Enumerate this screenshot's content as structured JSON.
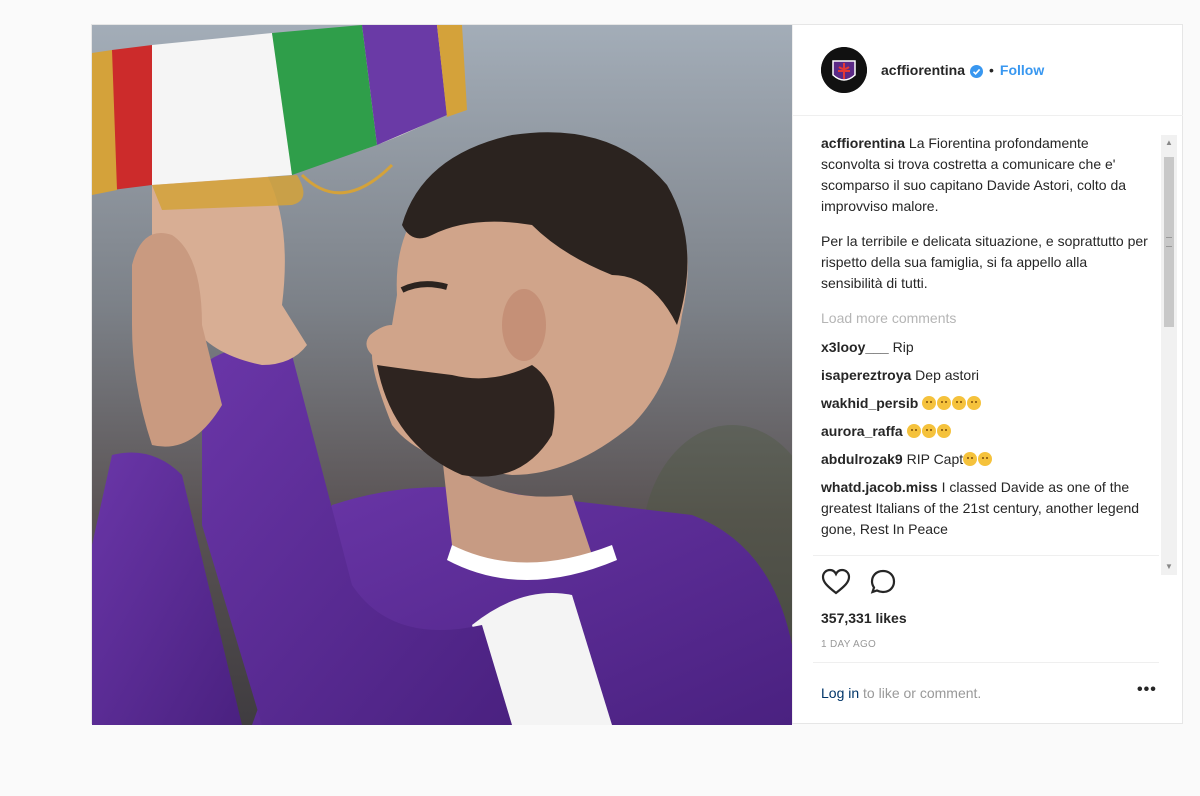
{
  "post": {
    "username": "acffiorentina",
    "follow_label": "Follow",
    "separator": "•",
    "caption_username": "acffiorentina",
    "caption_paragraph_1": "La Fiorentina profondamente sconvolta si trova costretta a comunicare che e' scomparso il suo capitano Davide Astori, colto da improvviso malore.",
    "caption_paragraph_2": "Per la terribile e delicata situazione, e soprattutto per rispetto della sua famiglia, si fa appello alla sensibilità di tutti.",
    "load_more": "Load more comments",
    "comments": [
      {
        "user": "x3looy___",
        "text": "Rip"
      },
      {
        "user": "isapereztroya",
        "text": "Dep astori"
      },
      {
        "user": "wakhid_persib",
        "text": ""
      },
      {
        "user": "aurora_raffa",
        "text": ""
      },
      {
        "user": "abdulrozak9",
        "text": "RIP Capt"
      },
      {
        "user": "whatd.jacob.miss",
        "text": "I classed Davide as one of the greatest Italians of the 21st century, another legend gone, Rest In Peace"
      }
    ],
    "likes": "357,331 likes",
    "time": "1 DAY AGO",
    "login_link": "Log in",
    "login_rest": " to like or comment.",
    "more_label": "•••",
    "colors": {
      "accent": "#3897f0",
      "purple": "#5b2a86",
      "text": "#262626"
    }
  }
}
